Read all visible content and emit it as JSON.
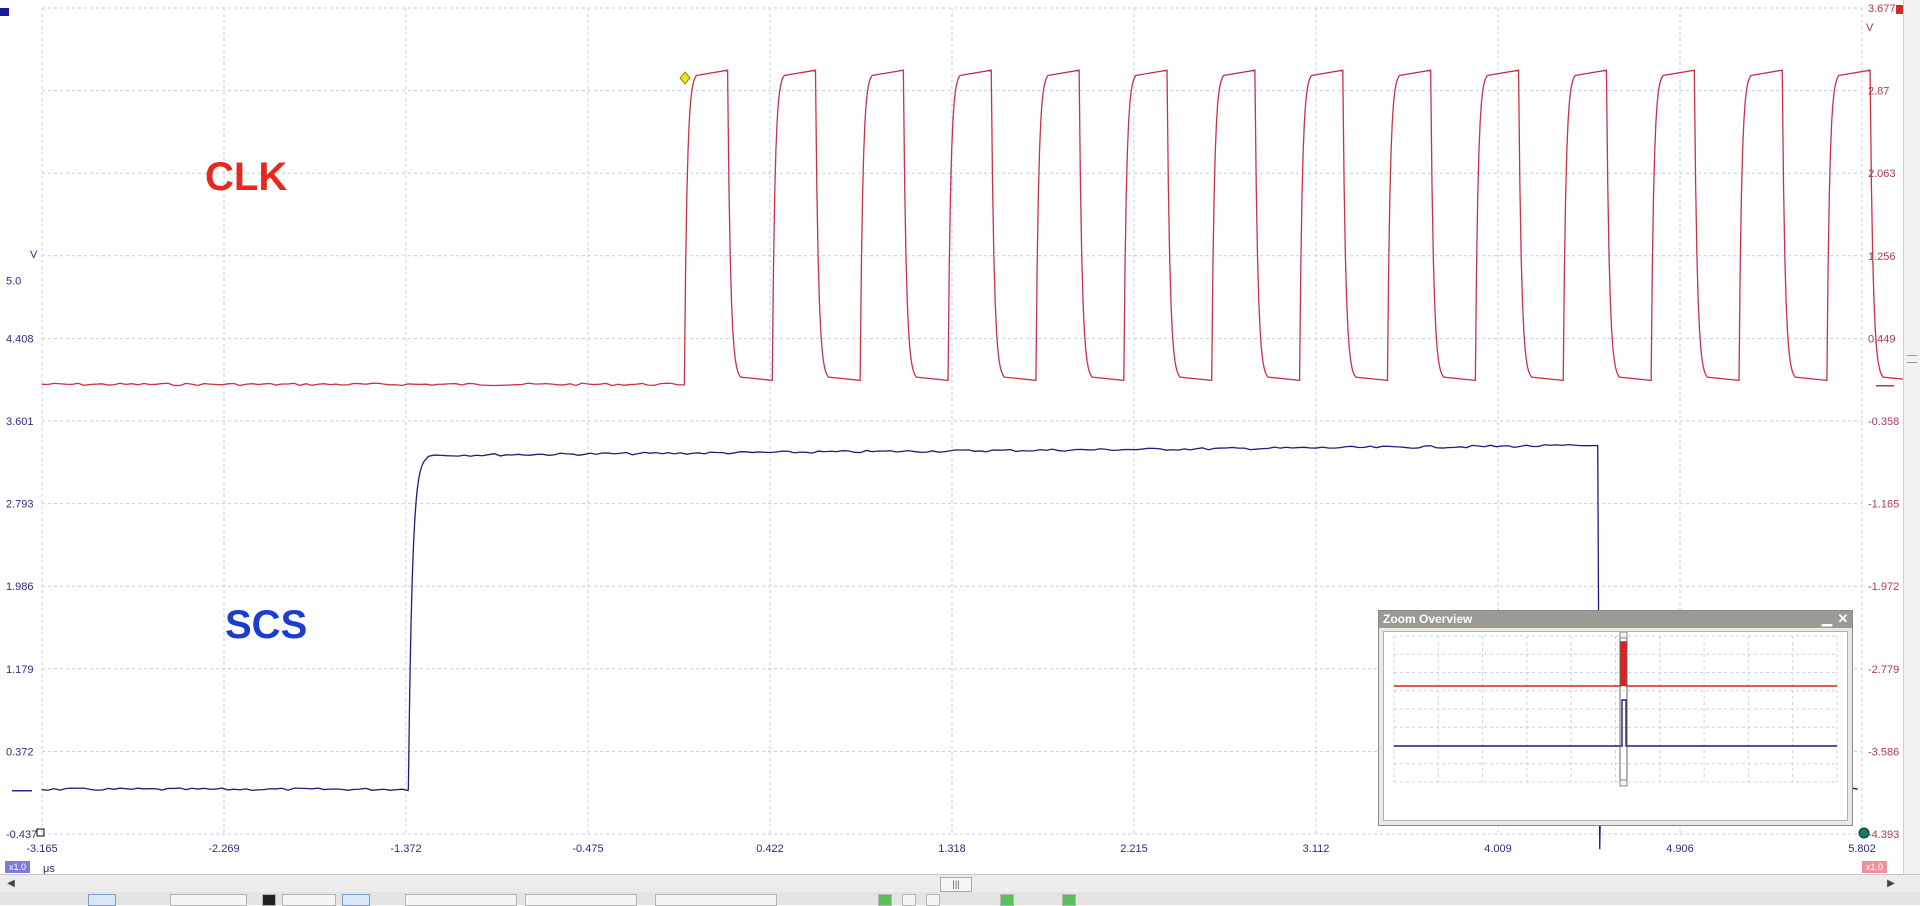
{
  "colors": {
    "clk": "#c83246",
    "scs": "#1e1e78",
    "clk_axis": "#b03a4a",
    "scs_axis": "#2c2c84",
    "grid": "#bcd0dc",
    "clk_label": "#e8281e",
    "scs_label": "#1c3ccc",
    "zoom_clk": "#e02020",
    "zoom_scs": "#1e1e78"
  },
  "channels": {
    "clk": {
      "label": "CLK",
      "unit": "V",
      "ticks": [
        "3.677",
        "2.87",
        "2.063",
        "1.256",
        "0.449",
        "-0.358",
        "-1.165",
        "-1.972",
        "-2.779",
        "-3.586",
        "-4.393"
      ]
    },
    "scs": {
      "label": "SCS",
      "unit": "V",
      "ticks": [
        "5.0",
        "4.408",
        "3.601",
        "2.793",
        "1.986",
        "1.179",
        "0.372",
        "-0.437"
      ]
    }
  },
  "time_axis": {
    "unit": "μs",
    "ticks": [
      "-3.165",
      "-2.269",
      "-1.372",
      "-0.475",
      "0.422",
      "1.318",
      "2.215",
      "3.112",
      "4.009",
      "4.906",
      "5.802"
    ],
    "range": [
      -3.165,
      5.802
    ]
  },
  "waveforms": {
    "clk": {
      "low_v": 0.0,
      "high_v": 3.05,
      "first_edge_us": 0.0,
      "period_us": 0.433,
      "duty": 0.56,
      "pulses": 16
    },
    "scs": {
      "low_v": 0.0,
      "high_v": 3.4,
      "rise_us": -1.36,
      "fall_us": 4.5
    }
  },
  "zoom_overview": {
    "title": "Zoom Overview",
    "minimize_icon": "minimize-icon",
    "close_icon": "close-icon"
  },
  "badges": {
    "left": "x1.0",
    "right": "x1.0"
  },
  "scrollbar": {
    "left_icon": "arrow-left-icon",
    "right_icon": "arrow-right-icon",
    "thumb_icon": "grip-icon"
  }
}
